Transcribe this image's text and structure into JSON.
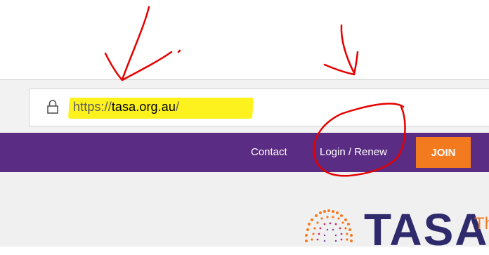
{
  "browser": {
    "url_scheme": "https://",
    "url_domain": "tasa.org.au",
    "url_trailing": "/"
  },
  "site_nav": {
    "contact_label": "Contact",
    "login_label": "Login / Renew",
    "join_label": "JOIN"
  },
  "logo": {
    "wordmark": "TASA",
    "tagline_fragment": "Th"
  },
  "colors": {
    "nav_purple": "#5b2c83",
    "join_orange": "#f47a20",
    "highlight_yellow": "#fdf21e",
    "annotation_red": "#e60000"
  }
}
